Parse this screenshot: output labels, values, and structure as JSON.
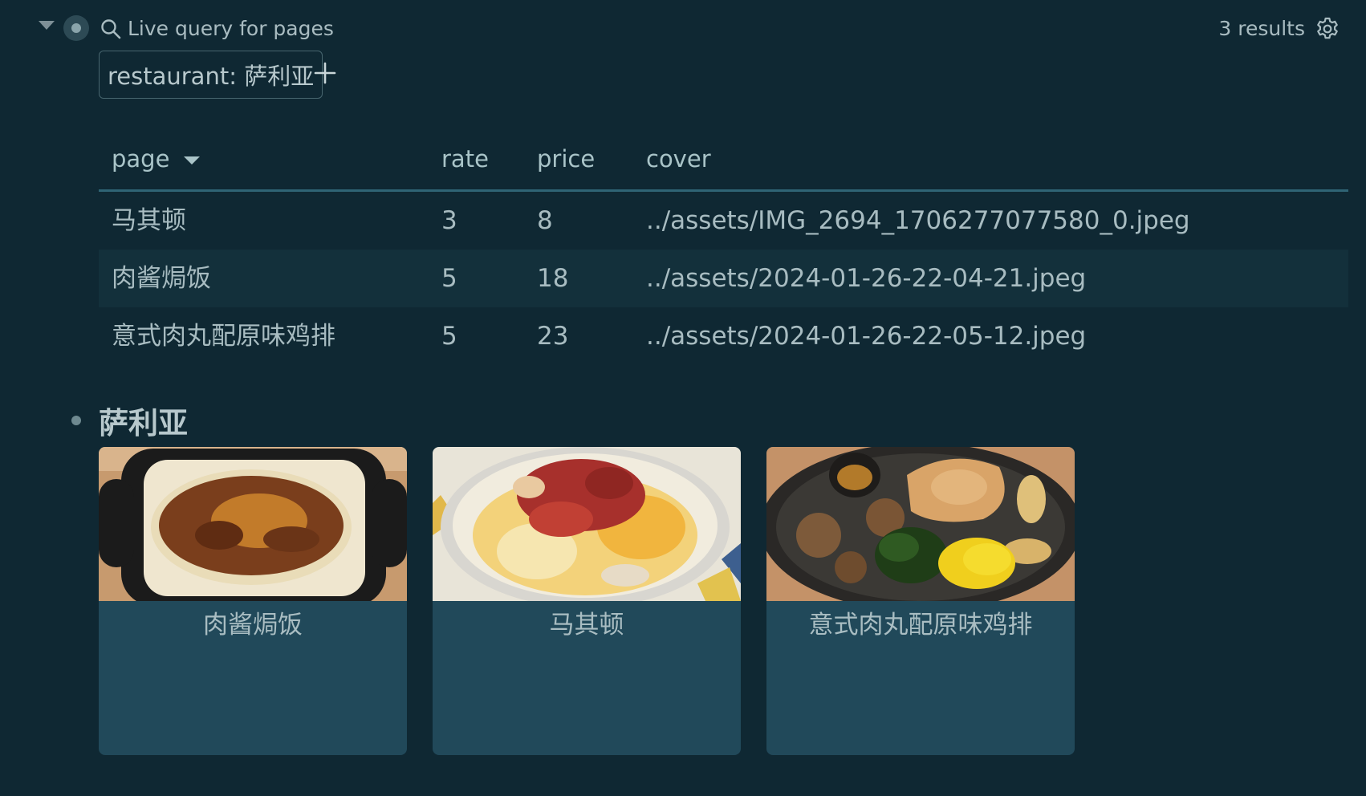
{
  "header": {
    "query_title": "Live query for pages",
    "results_count": "3 results",
    "filter_chip": "restaurant: 萨利亚"
  },
  "table": {
    "columns": {
      "page": "page",
      "rate": "rate",
      "price": "price",
      "cover": "cover"
    },
    "rows": [
      {
        "page": "马其顿",
        "rate": "3",
        "price": "8",
        "cover": "../assets/IMG_2694_1706277077580_0.jpeg"
      },
      {
        "page": "肉酱焗饭",
        "rate": "5",
        "price": "18",
        "cover": "../assets/2024-01-26-22-04-21.jpeg"
      },
      {
        "page": "意式肉丸配原味鸡排",
        "rate": "5",
        "price": "23",
        "cover": "../assets/2024-01-26-22-05-12.jpeg"
      }
    ]
  },
  "section": {
    "title": "萨利亚"
  },
  "gallery": {
    "cards": [
      {
        "caption": "肉酱焗饭",
        "image": "gratin-photo"
      },
      {
        "caption": "马其顿",
        "image": "fruit-cup-photo"
      },
      {
        "caption": "意式肉丸配原味鸡排",
        "image": "chicken-meatball-plate-photo"
      }
    ]
  },
  "colors": {
    "background": "#0f2833",
    "card": "#21495a",
    "header_divider": "#2f6475",
    "alt_row": "#13303b"
  },
  "icons": {
    "collapse": "triangle-down-icon",
    "bullet": "bullet-dot-icon",
    "search": "search-icon",
    "settings": "gear-icon",
    "add": "plus-icon",
    "sort": "sort-desc-icon"
  }
}
